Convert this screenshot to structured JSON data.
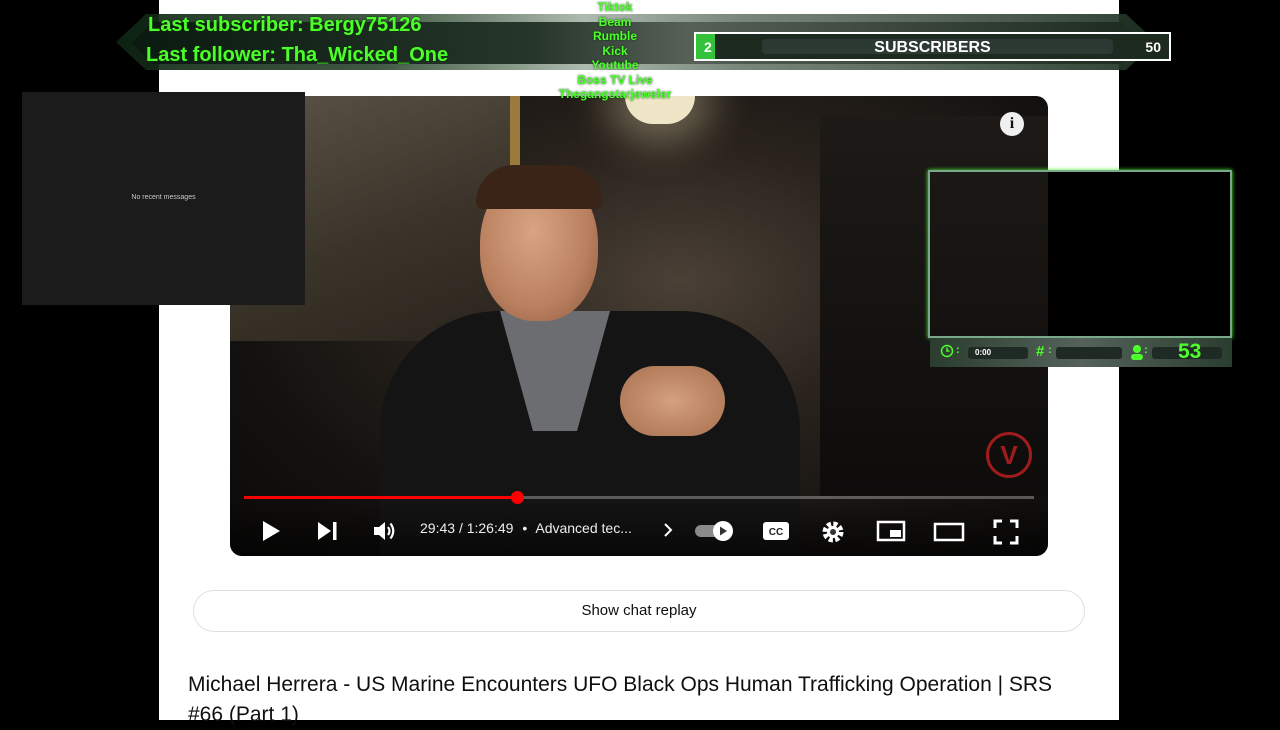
{
  "player": {
    "current_time": "29:43",
    "separator": "/",
    "duration": "1:26:49",
    "chapter": "Advanced tec...",
    "progress_fraction": 0.346,
    "info_icon": "i"
  },
  "page": {
    "chat_replay_label": "Show chat replay",
    "video_title": "Michael Herrera - US Marine Encounters UFO Black Ops Human Trafficking Operation | SRS #66 (Part 1)"
  },
  "overlay": {
    "last_subscriber": "Last subscriber: Bergy75126",
    "last_follower": "Last follower: Tha_Wicked_One",
    "platforms": [
      "Tiktok",
      "Beam",
      "Rumble",
      "Kick",
      "Youtube",
      "Boss TV Live",
      "Thegangstarjeweler"
    ],
    "sub_goal": {
      "current": "2",
      "label": "SUBSCRIBERS",
      "goal": "50",
      "fraction": 0.04
    },
    "chat_empty": "No recent messages",
    "stats": {
      "timer": "0:00",
      "viewers": "53"
    }
  },
  "icons": [
    "play-icon",
    "next-icon",
    "volume-icon",
    "chevron-right-icon",
    "autoplay-toggle-icon",
    "captions-icon",
    "settings-icon",
    "miniplayer-icon",
    "theater-icon",
    "fullscreen-icon",
    "clock-icon",
    "hash-icon",
    "viewer-icon"
  ],
  "colors": {
    "accent_red": "#ff0000",
    "overlay_green": "#4dff2a"
  }
}
